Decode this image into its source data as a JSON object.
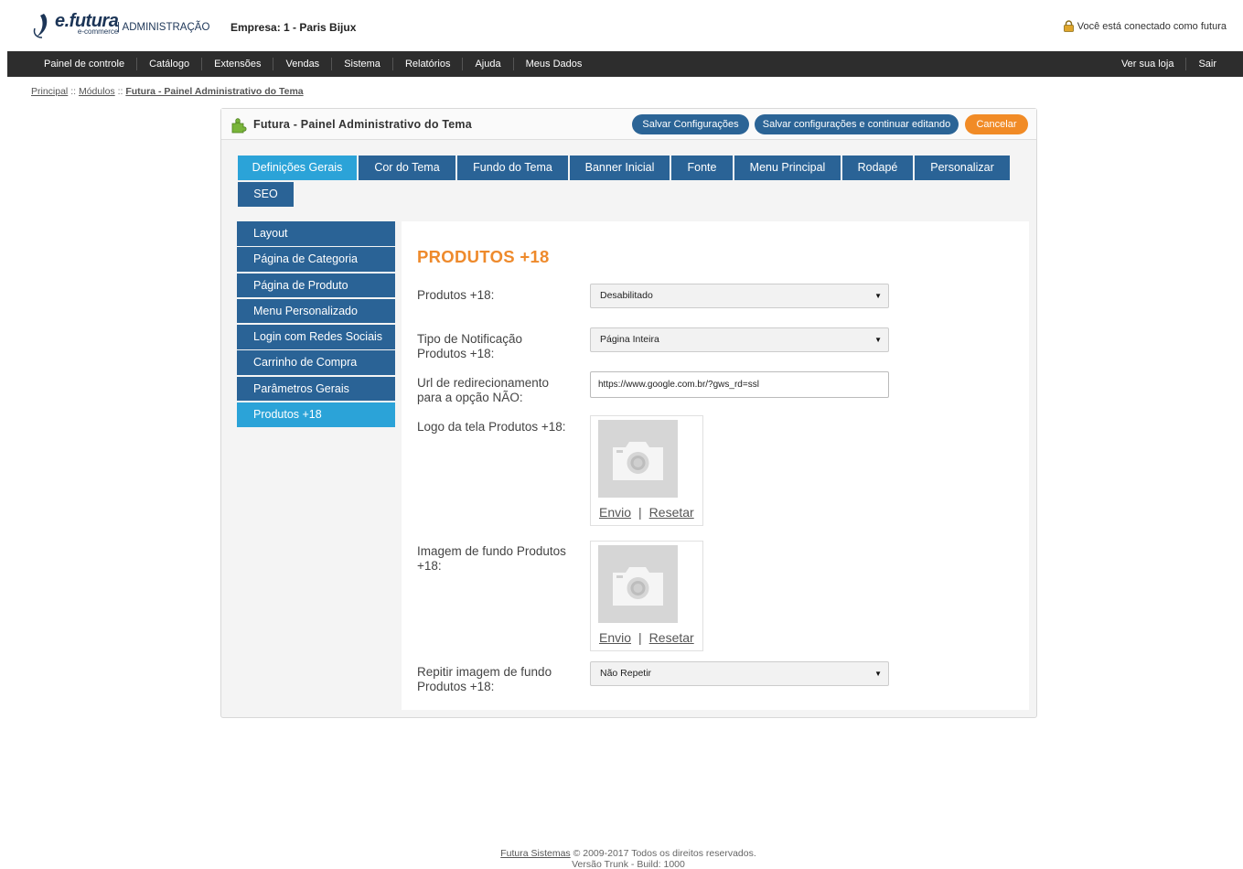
{
  "header": {
    "brand": "e.futura",
    "brand_sub": "e-commerce",
    "admin_label": "| ADMINISTRAÇÃO",
    "company": "Empresa: 1 - Paris Bijux",
    "user_status": "Você está conectado como futura"
  },
  "nav": {
    "left": [
      "Painel de controle",
      "Catálogo",
      "Extensões",
      "Vendas",
      "Sistema",
      "Relatórios",
      "Ajuda",
      "Meus Dados"
    ],
    "right": [
      "Ver sua loja",
      "Sair"
    ]
  },
  "breadcrumb": {
    "items": [
      "Principal",
      "Módulos",
      "Futura - Painel Administrativo do Tema"
    ],
    "separator": "::"
  },
  "panel": {
    "title": "Futura - Painel Administrativo do Tema",
    "buttons": {
      "save": "Salvar Configurações",
      "save_continue": "Salvar configurações e continuar editando",
      "cancel": "Cancelar"
    }
  },
  "tabs": [
    "Definições Gerais",
    "Cor do Tema",
    "Fundo do Tema",
    "Banner Inicial",
    "Fonte",
    "Menu Principal",
    "Rodapé",
    "Personalizar",
    "SEO"
  ],
  "active_tab": "Definições Gerais",
  "side_menu": [
    "Layout",
    "Página de Categoria",
    "Página de Produto",
    "Menu Personalizado",
    "Login com Redes Sociais",
    "Carrinho de Compra",
    "Parâmetros Gerais",
    "Produtos +18"
  ],
  "active_side": "Produtos +18",
  "content": {
    "section_title": "PRODUTOS +18",
    "fields": {
      "produtos18": {
        "label": "Produtos +18:",
        "value": "Desabilitado"
      },
      "tipo_notificacao": {
        "label": "Tipo de Notificação Produtos +18:",
        "value": "Página Inteira"
      },
      "url_redirect": {
        "label": "Url de redirecionamento para a opção NÃO:",
        "value": "https://www.google.com.br/?gws_rd=ssl"
      },
      "logo": {
        "label": "Logo da tela Produtos +18:",
        "upload": "Envio",
        "sep": "|",
        "reset": "Resetar"
      },
      "bg_image": {
        "label": "Imagem de fundo Produtos +18:",
        "upload": "Envio",
        "sep": "|",
        "reset": "Resetar"
      },
      "repeat_bg": {
        "label": "Repitir imagem de fundo Produtos +18:",
        "value": "Não Repetir"
      }
    }
  },
  "footer": {
    "link": "Futura Sistemas",
    "copyright": "© 2009-2017 Todos os direitos reservados.",
    "version": "Versão Trunk - Build: 1000"
  },
  "colors": {
    "navbar": "#2d2d2d",
    "tab": "#2a6396",
    "tab_active": "#2ba3d8",
    "accent_orange": "#f18b26",
    "title_orange": "#ee8a2c"
  }
}
